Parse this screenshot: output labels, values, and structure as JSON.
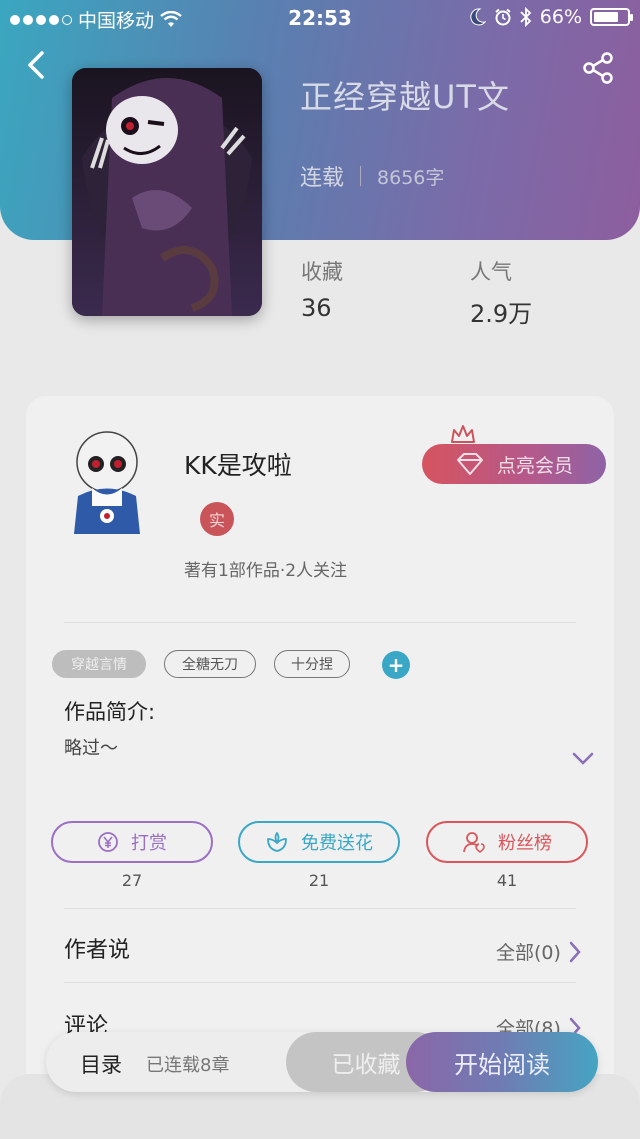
{
  "status_bar": {
    "carrier": "中国移动",
    "time": "22:53",
    "battery": "66%"
  },
  "book": {
    "title": "正经穿越UT文",
    "status": "连载",
    "word_count": "8656字",
    "stats": [
      {
        "label": "收藏",
        "value": "36"
      },
      {
        "label": "人气",
        "value": "2.9万"
      }
    ]
  },
  "author": {
    "name": "KK是攻啦",
    "badge": "实",
    "info": "著有1部作品·2人关注",
    "vip_button": "点亮会员"
  },
  "tags": [
    "穿越言情",
    "全糖无刀",
    "十分捏"
  ],
  "intro": {
    "heading": "作品简介:",
    "text": "略过～"
  },
  "actions": [
    {
      "label": "打赏",
      "count": "27",
      "icon": "yen-icon",
      "color": "#9b6fc2"
    },
    {
      "label": "免费送花",
      "count": "21",
      "icon": "flower-icon",
      "color": "#3aa7c7"
    },
    {
      "label": "粉丝榜",
      "count": "41",
      "icon": "fans-icon",
      "color": "#d9575c"
    }
  ],
  "rows": [
    {
      "label": "作者说",
      "right": "全部(0)"
    },
    {
      "label": "评论",
      "right": "全部(8)"
    }
  ],
  "bottom_bar": {
    "catalog": "目录",
    "serial": "已连载8章",
    "collected": "已收藏",
    "read": "开始阅读"
  },
  "colors": {
    "accent_purple": "#8d5e9e",
    "accent_teal": "#3aa7bf",
    "vip_red": "#d6545f"
  }
}
